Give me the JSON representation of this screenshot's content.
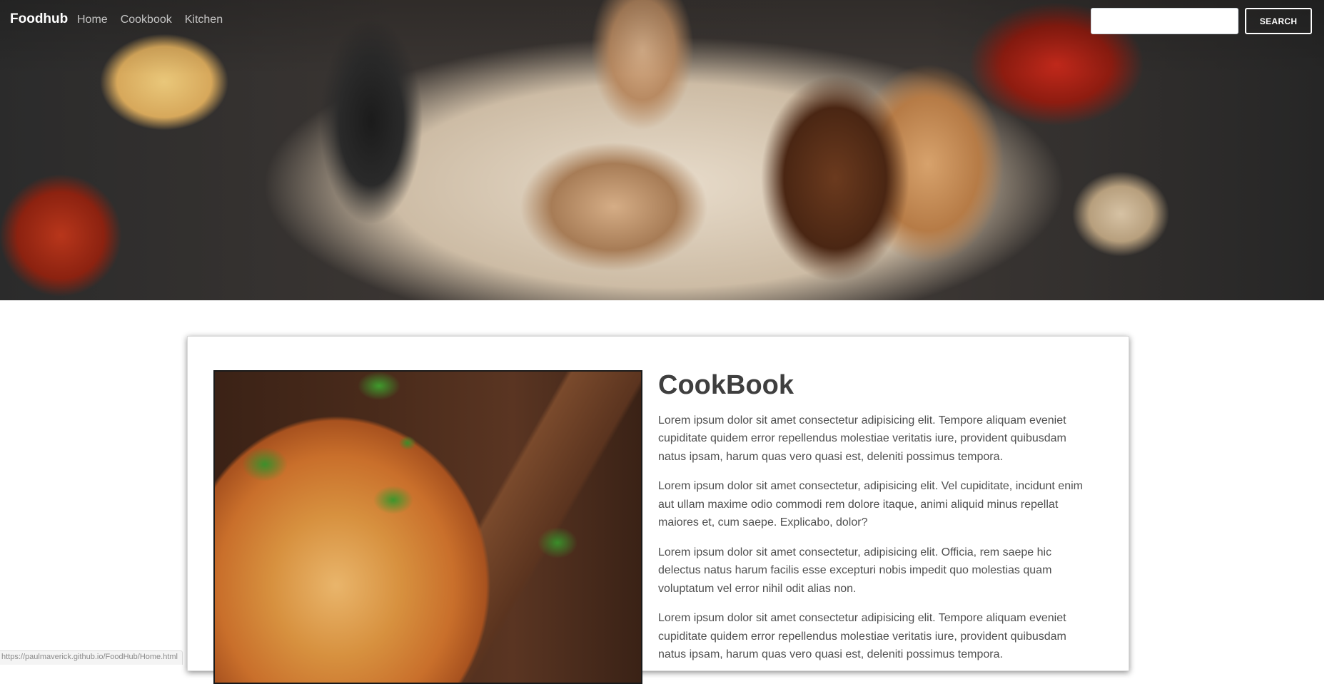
{
  "navbar": {
    "brand": "Foodhub",
    "links": [
      "Home",
      "Cookbook",
      "Kitchen"
    ],
    "search": {
      "placeholder": "",
      "button_label": "SEARCH"
    }
  },
  "card": {
    "title": "CookBook",
    "paragraphs": [
      "Lorem ipsum dolor sit amet consectetur adipisicing elit. Tempore aliquam eveniet cupiditate quidem error repellendus molestiae veritatis iure, provident quibusdam natus ipsam, harum quas vero quasi est, deleniti possimus tempora.",
      "Lorem ipsum dolor sit amet consectetur, adipisicing elit. Vel cupiditate, incidunt enim aut ullam maxime odio commodi rem dolore itaque, animi aliquid minus repellat maiores et, cum saepe. Explicabo, dolor?",
      "Lorem ipsum dolor sit amet consectetur, adipisicing elit. Officia, rem saepe hic delectus natus harum facilis esse excepturi nobis impedit quo molestias quam voluptatum vel error nihil odit alias non.",
      "Lorem ipsum dolor sit amet consectetur adipisicing elit. Tempore aliquam eveniet cupiditate quidem error repellendus molestiae veritatis iure, provident quibusdam natus ipsam, harum quas vero quasi est, deleniti possimus tempora."
    ]
  },
  "status_bar": {
    "url": "https://paulmaverick.github.io/FoodHub/Home.html"
  }
}
